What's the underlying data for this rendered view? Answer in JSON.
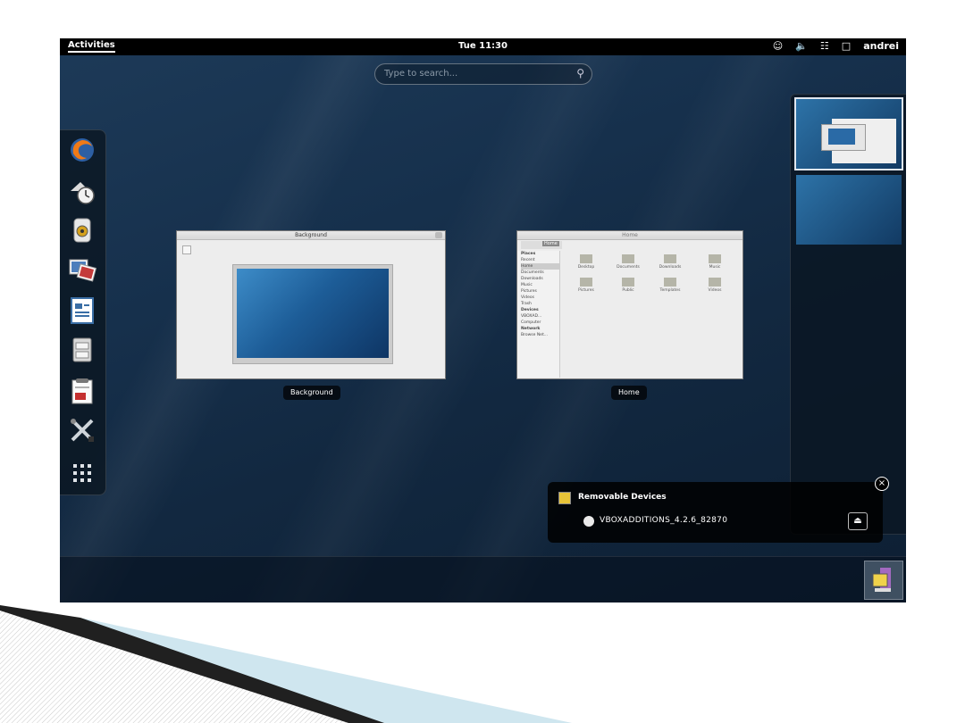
{
  "topbar": {
    "activities": "Activities",
    "clock": "Tue 11:30",
    "user": "andrei"
  },
  "search": {
    "placeholder": "Type to search..."
  },
  "windows": [
    {
      "title": "Background",
      "caption": "Background"
    },
    {
      "title": "Home",
      "caption": "Home"
    }
  ],
  "file_manager": {
    "sidebar": [
      "Places",
      "Recent",
      "Home",
      "Documents",
      "Downloads",
      "Music",
      "Pictures",
      "Videos",
      "Trash",
      "Devices",
      "VBOXAD...",
      "Computer",
      "Network",
      "Browse Net..."
    ],
    "folders": [
      "Desktop",
      "Documents",
      "Downloads",
      "Music",
      "Pictures",
      "Public",
      "Templates",
      "Videos"
    ],
    "location": "Home"
  },
  "notification": {
    "title": "Removable Devices",
    "device": "VBOXADDITIONS_4.2.6_82870"
  },
  "colors": {
    "desktop": "#16304c",
    "accent": "#ffffff"
  }
}
